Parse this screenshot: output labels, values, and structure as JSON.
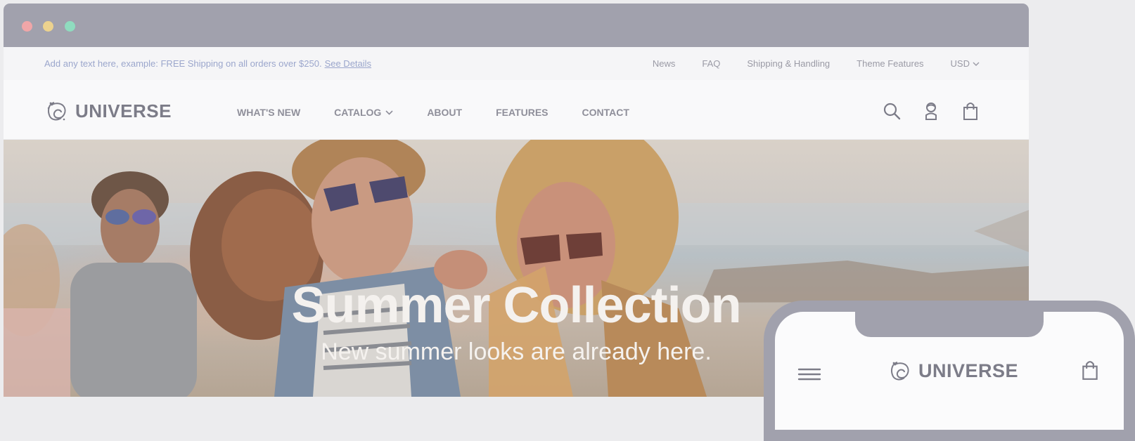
{
  "window": {
    "controls": [
      "close",
      "minimize",
      "maximize"
    ]
  },
  "promo": {
    "text": "Add any text here, example: FREE Shipping on all orders over $250.",
    "link": "See Details"
  },
  "utility_links": [
    "News",
    "FAQ",
    "Shipping & Handling",
    "Theme Features"
  ],
  "currency": "USD",
  "brand": {
    "name": "UNIVERSE",
    "icon": "universe-logo-icon"
  },
  "menu": [
    {
      "label": "WHAT'S NEW",
      "has_dropdown": false
    },
    {
      "label": "CATALOG",
      "has_dropdown": true
    },
    {
      "label": "ABOUT",
      "has_dropdown": false
    },
    {
      "label": "FEATURES",
      "has_dropdown": false
    },
    {
      "label": "CONTACT",
      "has_dropdown": false
    }
  ],
  "nav_icons": [
    "search-icon",
    "account-icon",
    "cart-bag-icon"
  ],
  "hero": {
    "title": "Summer Collection",
    "subtitle": "New summer looks are already here."
  },
  "phone": {
    "brand": "UNIVERSE",
    "icons": [
      "hamburger-menu-icon",
      "cart-bag-icon"
    ]
  },
  "colors": {
    "titlebar": "#a1a1ad",
    "promo_link": "#9ba6cc",
    "logo_text": "#7c7c88",
    "menu_text": "#8f8f9a"
  }
}
